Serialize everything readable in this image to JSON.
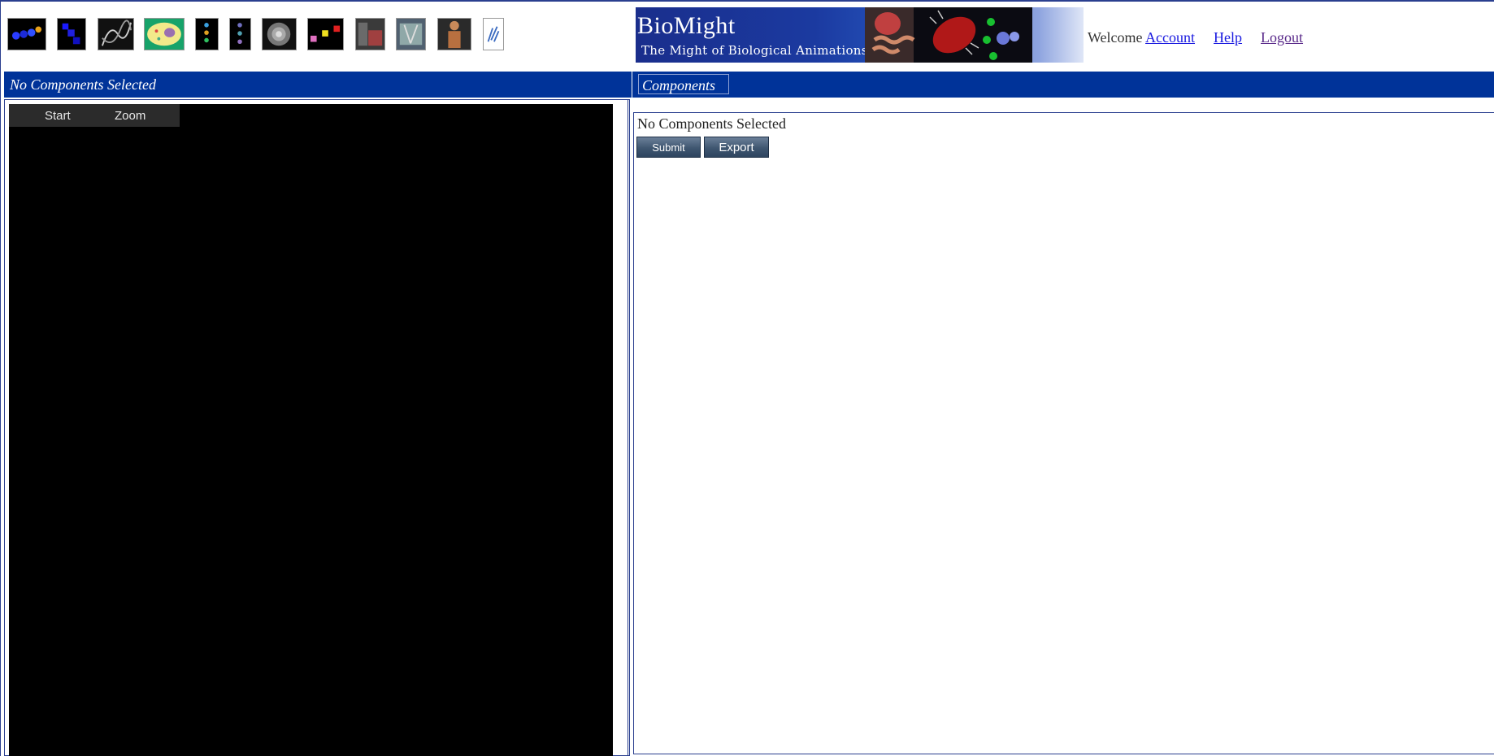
{
  "toolbar": {
    "thumbnails": [
      {
        "name": "molecule-chain-thumbnail"
      },
      {
        "name": "blue-cubes-thumbnail"
      },
      {
        "name": "dna-helix-thumbnail"
      },
      {
        "name": "cell-thumbnail"
      },
      {
        "name": "organelle-column-thumbnail"
      },
      {
        "name": "cell-column-thumbnail"
      },
      {
        "name": "sphere-thumbnail"
      },
      {
        "name": "color-blocks-thumbnail"
      },
      {
        "name": "tissue-thumbnail"
      },
      {
        "name": "skeleton-thumbnail"
      },
      {
        "name": "human-body-thumbnail"
      },
      {
        "name": "text-thumbnail"
      }
    ]
  },
  "banner": {
    "title": "BioMight",
    "subtitle": "The Might of Biological Animations"
  },
  "user_nav": {
    "welcome": "Welcome",
    "account": "Account",
    "help": "Help",
    "logout": "Logout"
  },
  "left_panel": {
    "header": "No Components Selected",
    "viewer_controls": {
      "start": "Start",
      "zoom": "Zoom"
    }
  },
  "right_panel": {
    "tab": "Components",
    "status": "No Components Selected",
    "submit_label": "Submit",
    "export_label": "Export"
  },
  "colors": {
    "header_bar": "#003399",
    "frame_border": "#2a3f8f",
    "viewer_background": "#000000",
    "button": "#3f5670"
  }
}
